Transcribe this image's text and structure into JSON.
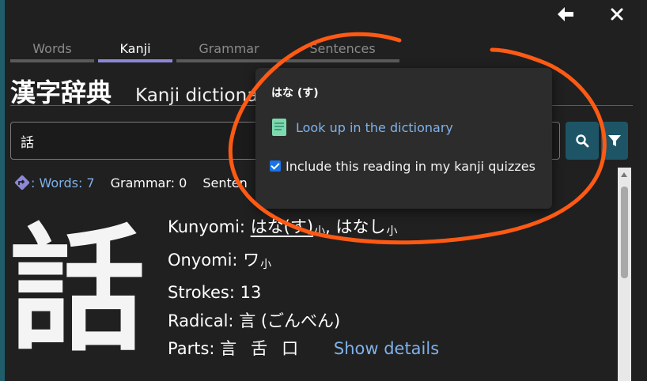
{
  "window": {
    "back_icon": "arrow-left-icon",
    "close_icon": "close-icon"
  },
  "tabs": [
    {
      "label": "Words",
      "active": false
    },
    {
      "label": "Kanji",
      "active": true
    },
    {
      "label": "Grammar",
      "active": false
    },
    {
      "label": "Sentences",
      "active": false
    }
  ],
  "title": {
    "japanese": "漢字辞典",
    "english": "Kanji dictionary"
  },
  "search": {
    "value": "話",
    "search_icon": "search-icon",
    "filter_icon": "filter-icon"
  },
  "counts": {
    "words_label": ": Words: 7",
    "grammar_label": "Grammar: 0",
    "sentences_label": "Senten"
  },
  "kanji": {
    "character": "話",
    "kunyomi_label": "Kunyomi:",
    "kunyomi_1": "はな(す)",
    "kunyomi_1_tag": "小",
    "kunyomi_sep": ",",
    "kunyomi_2": "はなし",
    "kunyomi_2_tag": "小",
    "onyomi_label": "Onyomi:",
    "onyomi_1": "ワ",
    "onyomi_1_tag": "小",
    "strokes_label": "Strokes: 13",
    "radical_label": "Radical:",
    "radical_value": "言 (ごんべん)",
    "parts_label": "Parts:",
    "parts": [
      "言",
      "舌",
      "口"
    ],
    "show_details": "Show details"
  },
  "popup": {
    "heading": "はな (す)",
    "lookup_label": "Look up in the dictionary",
    "include_label": "Include this reading in my kanji quizzes",
    "include_checked": true
  },
  "colors": {
    "accent_link": "#7fb1ea",
    "active_tab": "#8c87d6",
    "button_bg": "#1d5566",
    "annotation": "#ff5a14"
  }
}
